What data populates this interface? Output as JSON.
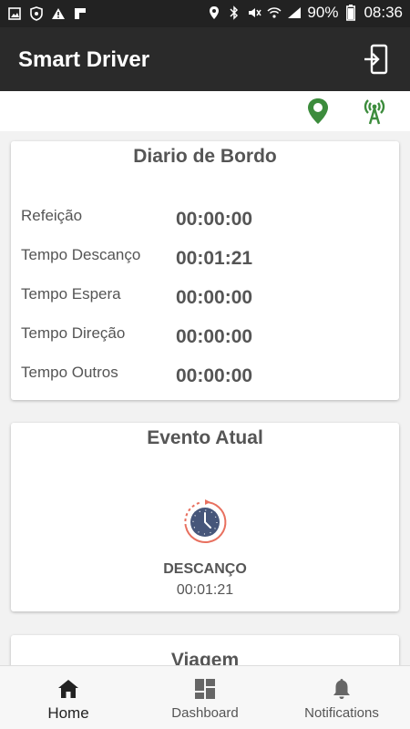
{
  "status_bar": {
    "battery": "90%",
    "time": "08:36"
  },
  "app_bar": {
    "title": "Smart Driver"
  },
  "colors": {
    "appbar": "#2a2a2a",
    "indicator_green": "#3c8c3c",
    "clock_blue": "#46567a",
    "clock_ring": "#e8705f"
  },
  "diario": {
    "title": "Diario de Bordo",
    "rows": [
      {
        "label": "Refeição",
        "value": "00:00:00"
      },
      {
        "label": "Tempo Descanço",
        "value": "00:01:21"
      },
      {
        "label": "Tempo Espera",
        "value": "00:00:00"
      },
      {
        "label": "Tempo Direção",
        "value": "00:00:00"
      },
      {
        "label": "Tempo Outros",
        "value": "00:00:00"
      }
    ]
  },
  "evento": {
    "title": "Evento Atual",
    "name": "DESCANÇO",
    "time": "00:01:21"
  },
  "viagem": {
    "title": "Viagem"
  },
  "bottom_nav": {
    "items": [
      {
        "label": "Home",
        "icon": "home-icon",
        "active": true
      },
      {
        "label": "Dashboard",
        "icon": "dashboard-icon",
        "active": false
      },
      {
        "label": "Notifications",
        "icon": "bell-icon",
        "active": false
      }
    ]
  }
}
